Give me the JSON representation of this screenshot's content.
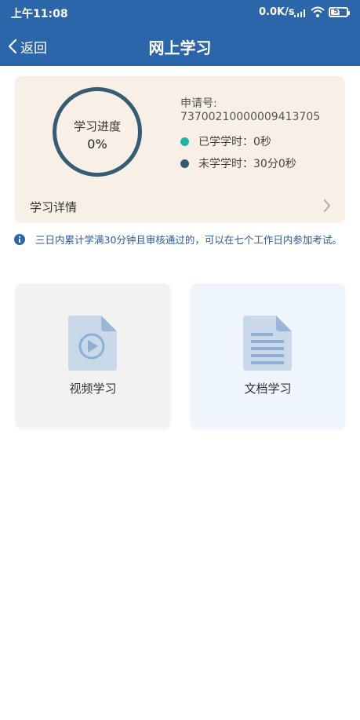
{
  "status_bar": {
    "time": "上午11:08",
    "network_speed": "0.0K/s",
    "battery_level": "59",
    "battery_fraction": 0.59
  },
  "nav": {
    "back_label": "返回",
    "title": "网上学习"
  },
  "progress": {
    "ring_label": "学习进度",
    "percent": "0%",
    "application_number_label": "申请号:",
    "application_number": "73700210000009413705",
    "studied_time": "已学学时：0秒",
    "remaining_time": "未学学时：30分0秒",
    "detail_label": "学习详情"
  },
  "notice": {
    "text": "三日内累计学满30分钟且审核通过的，可以在七个工作日内参加考试。"
  },
  "modules": {
    "video_label": "视频学习",
    "doc_label": "文档学习"
  },
  "colors": {
    "header_blue": "#2c66aa",
    "studied_dot": "#1ab3a6",
    "remaining_dot": "#365c73",
    "ring": "#365c73",
    "notice_text": "#2c5a96"
  },
  "icons": {
    "back": "chevron-left-icon",
    "detail": "chevron-right-icon",
    "info": "info-icon",
    "video": "video-file-icon",
    "doc": "document-file-icon"
  }
}
